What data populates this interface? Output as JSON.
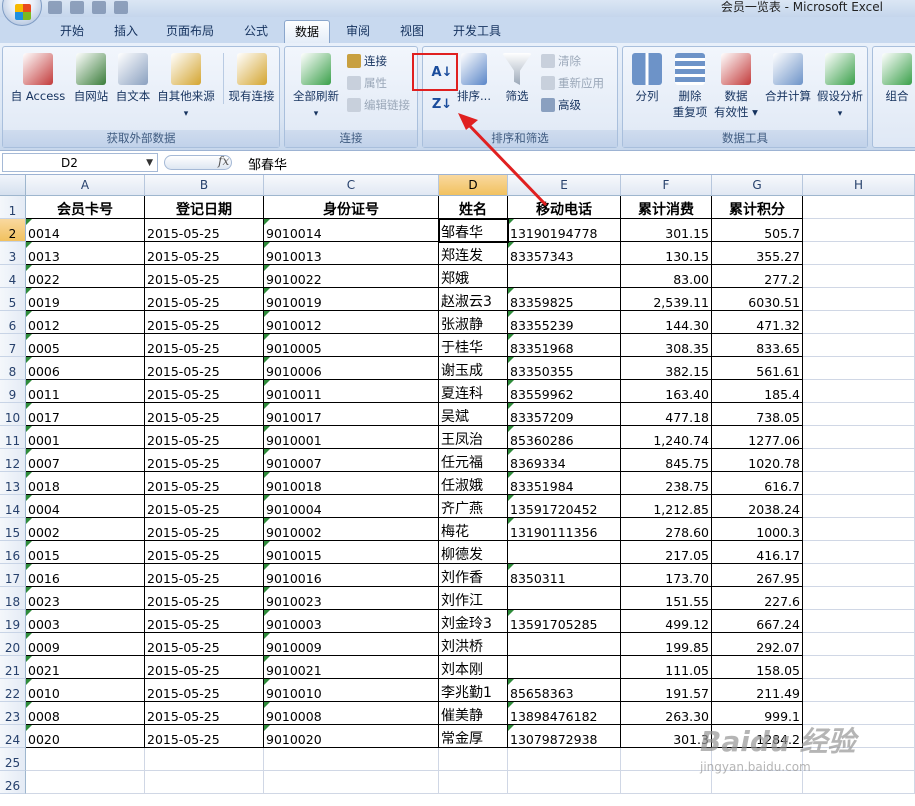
{
  "window": {
    "title": "会员一览表 - Microsoft Excel"
  },
  "tabs": [
    "开始",
    "插入",
    "页面布局",
    "公式",
    "数据",
    "审阅",
    "视图",
    "开发工具"
  ],
  "active_tab": "数据",
  "ribbon": {
    "external": {
      "label": "获取外部数据",
      "buttons": [
        "自 Access",
        "自网站",
        "自文本",
        "自其他来源",
        "现有连接"
      ]
    },
    "connections": {
      "label": "连接",
      "refresh": "全部刷新",
      "small": [
        "连接",
        "属性",
        "编辑链接"
      ]
    },
    "sort": {
      "label": "排序和筛选",
      "sort": "排序...",
      "filter": "筛选",
      "small": [
        "清除",
        "重新应用",
        "高级"
      ]
    },
    "tools": {
      "label": "数据工具",
      "buttons": [
        "分列",
        "删除\n重复项",
        "数据\n有效性 ▾",
        "合并计算",
        "假设分析"
      ]
    },
    "outline": {
      "buttons": [
        "组合"
      ]
    }
  },
  "formula_bar": {
    "name_box": "D2",
    "fx": "fx",
    "content": "邹春华"
  },
  "columns": [
    "A",
    "B",
    "C",
    "D",
    "E",
    "F",
    "G",
    "H"
  ],
  "rows": [
    "1",
    "2",
    "3",
    "4",
    "5",
    "6",
    "7",
    "8",
    "9",
    "10",
    "11",
    "12",
    "13",
    "14",
    "15",
    "16",
    "17",
    "18",
    "19",
    "20",
    "21",
    "22",
    "23",
    "24",
    "25",
    "26"
  ],
  "headers": [
    "会员卡号",
    "登记日期",
    "身份证号",
    "姓名",
    "移动电话",
    "累计消费",
    "累计积分"
  ],
  "records": [
    [
      "0014",
      "2015-05-25",
      "9010014",
      "邹春华",
      "13190194778",
      "301.15",
      "505.7"
    ],
    [
      "0013",
      "2015-05-25",
      "9010013",
      "郑连发",
      "83357343",
      "130.15",
      "355.27"
    ],
    [
      "0022",
      "2015-05-25",
      "9010022",
      "郑娥",
      "",
      "83.00",
      "277.2"
    ],
    [
      "0019",
      "2015-05-25",
      "9010019",
      "赵淑云3",
      "83359825",
      "2,539.11",
      "6030.51"
    ],
    [
      "0012",
      "2015-05-25",
      "9010012",
      "张淑静",
      "83355239",
      "144.30",
      "471.32"
    ],
    [
      "0005",
      "2015-05-25",
      "9010005",
      "于桂华",
      "83351968",
      "308.35",
      "833.65"
    ],
    [
      "0006",
      "2015-05-25",
      "9010006",
      "谢玉成",
      "83350355",
      "382.15",
      "561.61"
    ],
    [
      "0011",
      "2015-05-25",
      "9010011",
      "夏连科",
      "83559962",
      "163.40",
      "185.4"
    ],
    [
      "0017",
      "2015-05-25",
      "9010017",
      "吴斌",
      "83357209",
      "477.18",
      "738.05"
    ],
    [
      "0001",
      "2015-05-25",
      "9010001",
      "王凤治",
      "85360286",
      "1,240.74",
      "1277.06"
    ],
    [
      "0007",
      "2015-05-25",
      "9010007",
      "任元福",
      "8369334",
      "845.75",
      "1020.78"
    ],
    [
      "0018",
      "2015-05-25",
      "9010018",
      "任淑娥",
      "83351984",
      "238.75",
      "616.7"
    ],
    [
      "0004",
      "2015-05-25",
      "9010004",
      "齐广燕",
      "13591720452",
      "1,212.85",
      "2038.24"
    ],
    [
      "0002",
      "2015-05-25",
      "9010002",
      "梅花",
      "13190111356",
      "278.60",
      "1000.3"
    ],
    [
      "0015",
      "2015-05-25",
      "9010015",
      "柳德发",
      "",
      "217.05",
      "416.17"
    ],
    [
      "0016",
      "2015-05-25",
      "9010016",
      "刘作香",
      "8350311",
      "173.70",
      "267.95"
    ],
    [
      "0023",
      "2015-05-25",
      "9010023",
      "刘作江",
      "",
      "151.55",
      "227.6"
    ],
    [
      "0003",
      "2015-05-25",
      "9010003",
      "刘金玲3",
      "13591705285",
      "499.12",
      "667.24"
    ],
    [
      "0009",
      "2015-05-25",
      "9010009",
      "刘洪桥",
      "",
      "199.85",
      "292.07"
    ],
    [
      "0021",
      "2015-05-25",
      "9010021",
      "刘本刚",
      "",
      "111.05",
      "158.05"
    ],
    [
      "0010",
      "2015-05-25",
      "9010010",
      "李兆勤1",
      "85658363",
      "191.57",
      "211.49"
    ],
    [
      "0008",
      "2015-05-25",
      "9010008",
      "催美静",
      "13898476182",
      "263.30",
      "999.1"
    ],
    [
      "0020",
      "2015-05-25",
      "9010020",
      "常金厚",
      "13079872938",
      "301.3",
      "1284.2"
    ]
  ],
  "watermark": "Baidu 经验\njingyan.baidu.com",
  "colors": {
    "highlight": "#e02020",
    "selected_header": "#f4c767"
  }
}
